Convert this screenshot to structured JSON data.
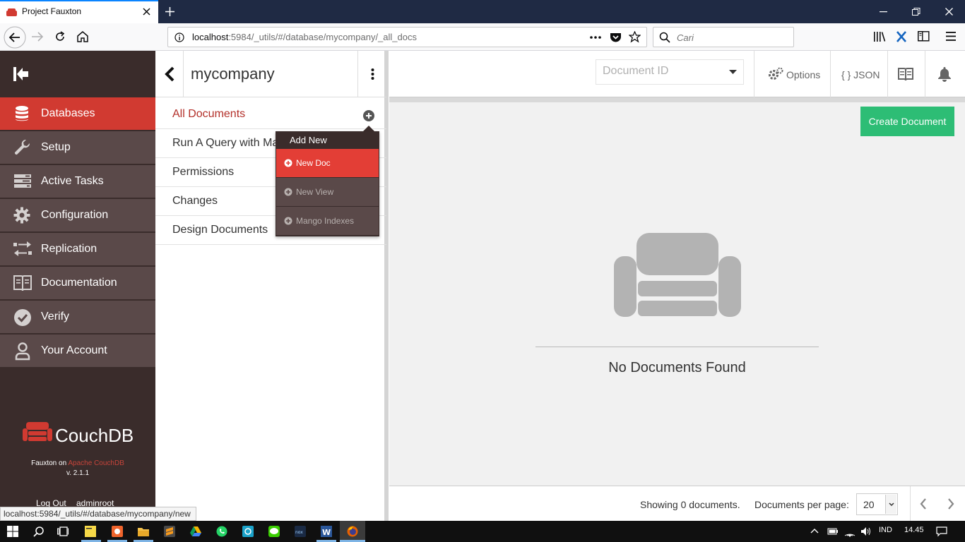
{
  "browser": {
    "tab_title": "Project Fauxton",
    "url_host": "localhost",
    "url_rest": ":5984/_utils/#/database/mycompany/_all_docs",
    "search_placeholder": "Cari",
    "status_url": "localhost:5984/_utils/#/database/mycompany/new"
  },
  "nav": {
    "items": [
      {
        "label": "Databases",
        "icon": "database-icon",
        "active": true
      },
      {
        "label": "Setup",
        "icon": "wrench-icon"
      },
      {
        "label": "Active Tasks",
        "icon": "tasks-icon"
      },
      {
        "label": "Configuration",
        "icon": "gear-icon"
      },
      {
        "label": "Replication",
        "icon": "replication-icon"
      },
      {
        "label": "Documentation",
        "icon": "book-icon"
      },
      {
        "label": "Verify",
        "icon": "check-circle-icon"
      },
      {
        "label": "Your Account",
        "icon": "user-icon"
      }
    ],
    "brand": "CouchDB",
    "fauxton_on": "Fauxton on",
    "apache": "Apache CouchDB",
    "version": "v. 2.1.1",
    "logout": "Log Out",
    "user": "adminroot"
  },
  "sidebar": {
    "db_name": "mycompany",
    "items": [
      {
        "label": "All Documents",
        "active": true
      },
      {
        "label": "Run A Query with Mango"
      },
      {
        "label": "Permissions"
      },
      {
        "label": "Changes"
      },
      {
        "label": "Design Documents"
      }
    ],
    "dropdown": {
      "header": "Add New",
      "items": [
        "New Doc",
        "New View",
        "Mango Indexes"
      ]
    }
  },
  "main": {
    "docid_placeholder": "Document ID",
    "options_label": "Options",
    "json_label": "{ } JSON",
    "create_button": "Create Document",
    "empty_message": "No Documents Found",
    "showing": "Showing 0 documents.",
    "per_page_label": "Documents per page:",
    "per_page_value": "20"
  },
  "taskbar": {
    "lang": "IND",
    "time": "14.45"
  },
  "colors": {
    "couch_red": "#d13a31",
    "create_green": "#2dbd75",
    "nav_bg": "#3a2c2b"
  }
}
